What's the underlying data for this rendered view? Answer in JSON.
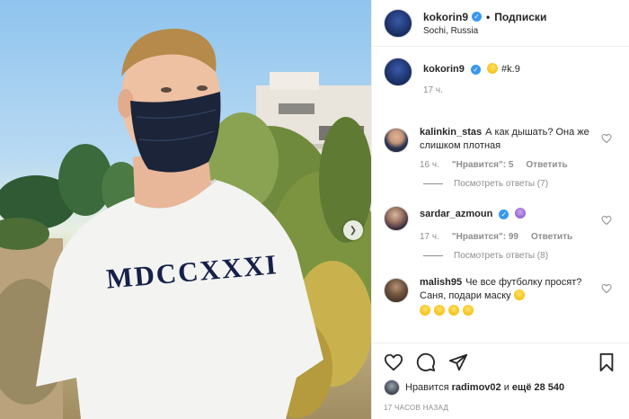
{
  "post": {
    "username": "kokorin9",
    "follow_label": "Подписки",
    "location": "Sochi, Russia",
    "tee_print": "MDCCXXXI"
  },
  "caption": {
    "username": "kokorin9",
    "text": "#k.9",
    "time": "17 ч."
  },
  "comments": [
    {
      "username": "kalinkin_stas",
      "text": "А как дышать? Она же слишком плотная",
      "time": "16 ч.",
      "likes": "\"Нравится\": 5",
      "reply": "Ответить",
      "view_replies": "Посмотреть ответы (7)"
    },
    {
      "username": "sardar_azmoun",
      "text": "",
      "time": "17 ч.",
      "likes": "\"Нравится\": 99",
      "reply": "Ответить",
      "view_replies": "Посмотреть ответы (8)"
    },
    {
      "username": "malish95",
      "text": "Че все футболку просят? Саня, подари маску"
    }
  ],
  "actions": {
    "icons": [
      "heart-icon",
      "comment-icon",
      "share-icon",
      "bookmark-icon"
    ]
  },
  "likes_line": {
    "prefix": "Нравится",
    "user": "radimov02",
    "suffix": "и",
    "others": "ещё 28 540"
  },
  "timestamp": "17 ЧАСОВ НАЗАД",
  "colors": {
    "verified": "#3897f0",
    "muted": "#8e8e8e",
    "text": "#262626"
  }
}
